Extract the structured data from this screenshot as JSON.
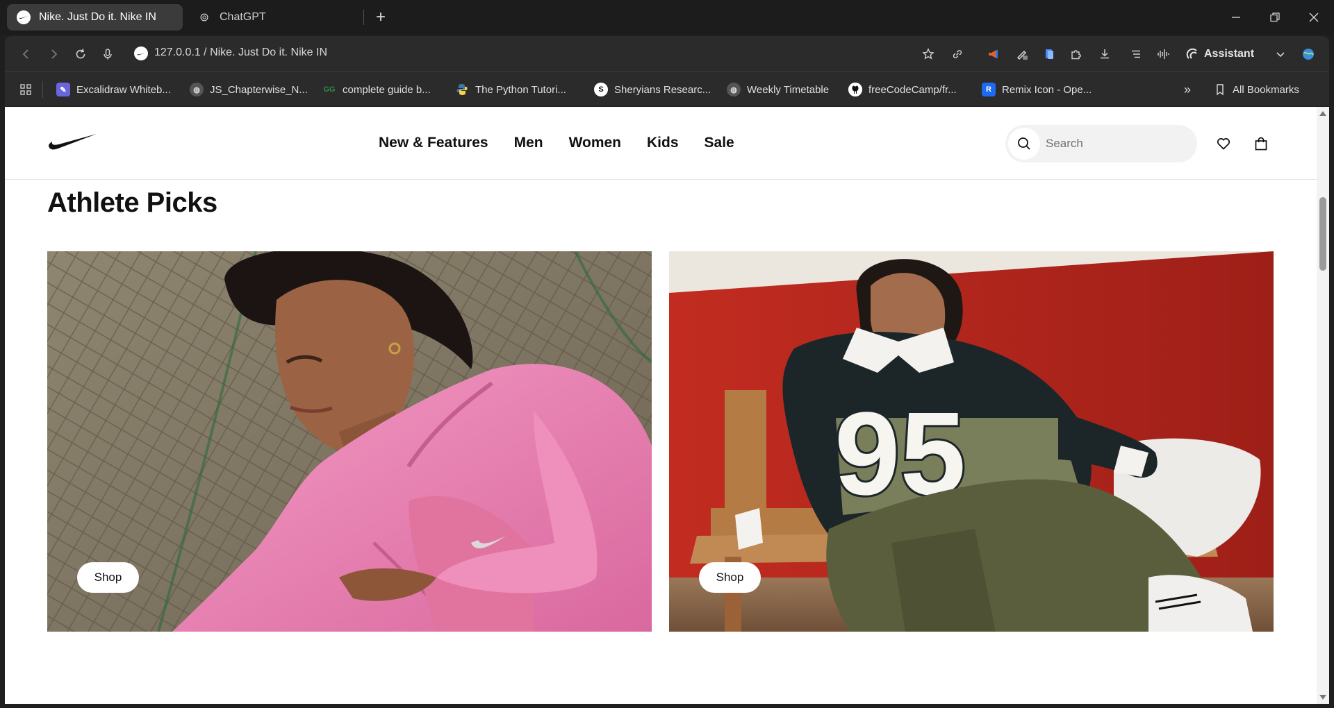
{
  "browser": {
    "tabs": [
      {
        "title": "Nike. Just Do it. Nike IN",
        "icon": "nike-swoosh-icon",
        "active": true
      },
      {
        "title": "ChatGPT",
        "icon": "chatgpt-icon",
        "active": false
      }
    ],
    "address": "127.0.0.1 / Nike. Just Do it. Nike IN",
    "assistant_label": "Assistant",
    "bookmarks": [
      {
        "label": "Excalidraw Whiteb...",
        "icon": "excalidraw-icon"
      },
      {
        "label": "JS_Chapterwise_N...",
        "icon": "globe-icon"
      },
      {
        "label": "complete guide b...",
        "icon": "geeksforgeeks-icon"
      },
      {
        "label": "The Python Tutori...",
        "icon": "python-icon"
      },
      {
        "label": "Sheryians Researc...",
        "icon": "sheryians-icon"
      },
      {
        "label": "Weekly Timetable",
        "icon": "globe-icon"
      },
      {
        "label": "freeCodeCamp/fr...",
        "icon": "github-icon"
      },
      {
        "label": "Remix Icon - Ope...",
        "icon": "remix-icon"
      }
    ],
    "all_bookmarks_label": "All Bookmarks"
  },
  "site": {
    "nav": [
      "New & Features",
      "Men",
      "Women",
      "Kids",
      "Sale"
    ],
    "search_placeholder": "Search",
    "section_title": "Athlete Picks",
    "cards": [
      {
        "button_label": "Shop"
      },
      {
        "button_label": "Shop"
      }
    ]
  },
  "colors": {
    "browser_bg": "#1f1f1f",
    "toolbar_bg": "#2b2b2b",
    "page_bg": "#ffffff",
    "card1_jacket_pink": "#e87fb0",
    "card2_wall_red": "#b3261e"
  }
}
